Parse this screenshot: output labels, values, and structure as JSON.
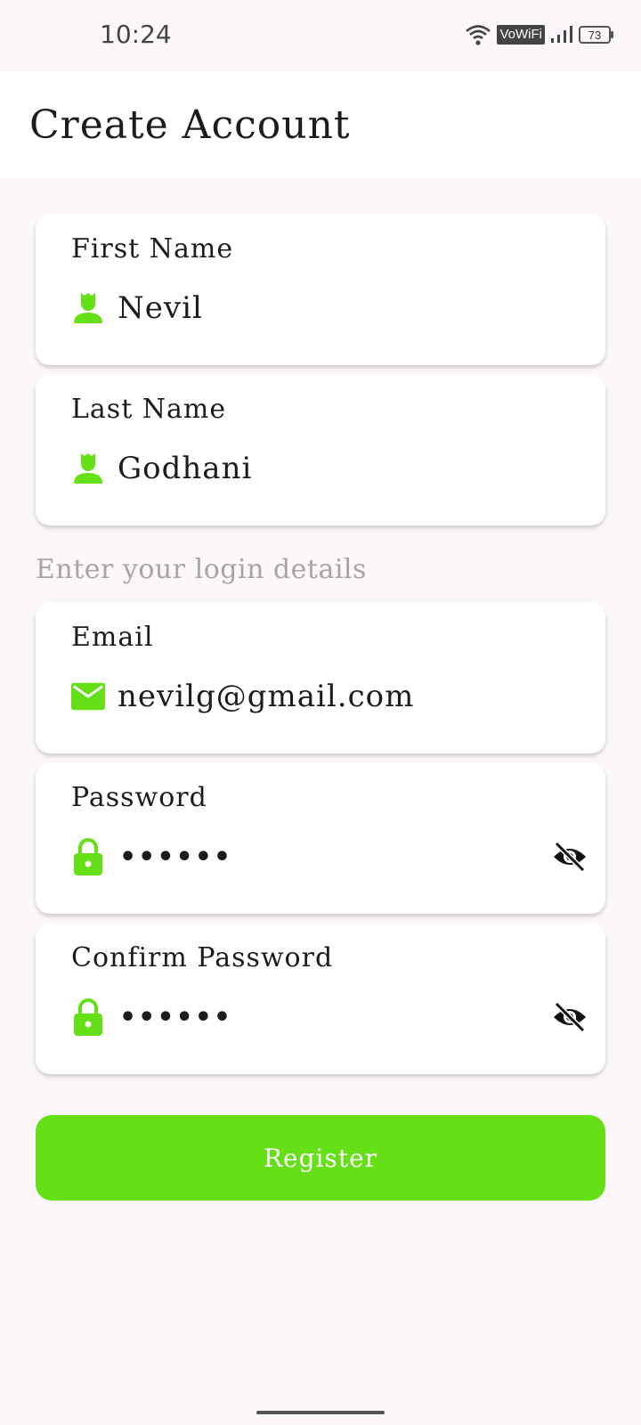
{
  "status_bar": {
    "time": "10:24",
    "vowifi": "VoWiFi",
    "battery": "73"
  },
  "app_bar": {
    "title": "Create Account"
  },
  "form": {
    "first_name": {
      "label": "First Name",
      "value": "Nevil",
      "icon": "person-icon"
    },
    "last_name": {
      "label": "Last Name",
      "value": "Godhani",
      "icon": "person-icon"
    },
    "section_heading": "Enter your login details",
    "email": {
      "label": "Email",
      "value": "nevilg@gmail.com",
      "icon": "mail-icon"
    },
    "password": {
      "label": "Password",
      "value": "••••••",
      "icon": "lock-icon",
      "toggle_icon": "eye-off-icon"
    },
    "confirm_password": {
      "label": "Confirm Password",
      "value": "••••••",
      "icon": "lock-icon",
      "toggle_icon": "eye-off-icon"
    },
    "register_label": "Register"
  },
  "colors": {
    "accent": "#65e016",
    "background": "#fcf7fb",
    "muted_text": "#a7a3a7"
  }
}
